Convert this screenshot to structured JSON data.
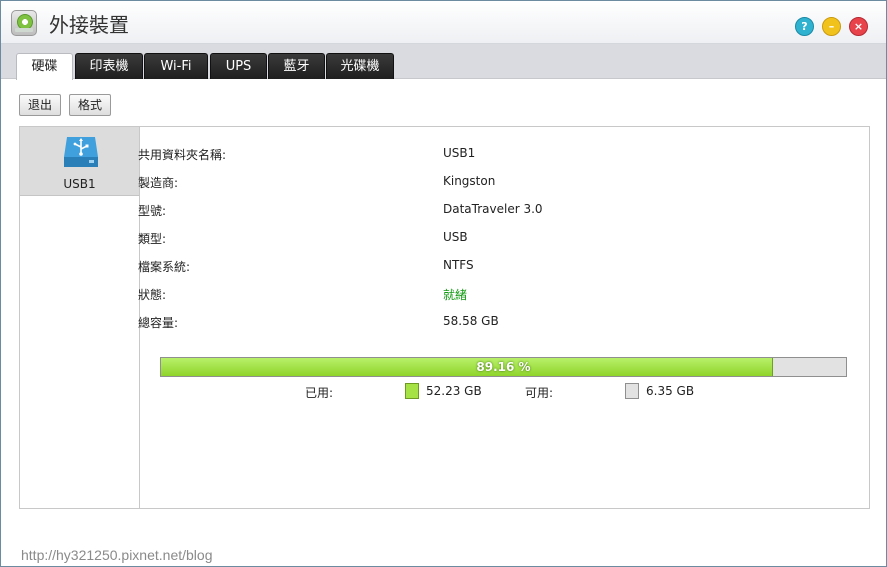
{
  "window": {
    "title": "外接裝置",
    "icon": "external-device-app-icon",
    "controls": {
      "help": "?",
      "minimize": "–",
      "close": "×"
    }
  },
  "tabs": [
    {
      "label": "硬碟",
      "active": true
    },
    {
      "label": "印表機",
      "active": false
    },
    {
      "label": "Wi-Fi",
      "active": false
    },
    {
      "label": "UPS",
      "active": false
    },
    {
      "label": "藍牙",
      "active": false
    },
    {
      "label": "光碟機",
      "active": false
    }
  ],
  "toolbar": {
    "eject_label": "退出",
    "format_label": "格式"
  },
  "sidebar": {
    "devices": [
      {
        "label": "USB1",
        "icon": "usb-drive-icon",
        "selected": true
      }
    ]
  },
  "details": {
    "rows": [
      {
        "label": "共用資料夾名稱:",
        "value": "USB1"
      },
      {
        "label": "製造商:",
        "value": "Kingston"
      },
      {
        "label": "型號:",
        "value": "DataTraveler 3.0"
      },
      {
        "label": "類型:",
        "value": "USB"
      },
      {
        "label": "檔案系統:",
        "value": "NTFS"
      },
      {
        "label": "狀態:",
        "value": "就緒"
      },
      {
        "label": "總容量:",
        "value": "58.58 GB"
      }
    ]
  },
  "usage": {
    "percent_text": "89.16 %",
    "used_fraction": 0.8916,
    "used_label": "已用:",
    "used_value": "52.23 GB",
    "free_label": "可用:",
    "free_value": "6.35 GB",
    "colors": {
      "used": "#a6e244",
      "free": "#e2e2e2",
      "status_ok": "#139a13"
    }
  },
  "watermark": "http://hy321250.pixnet.net/blog"
}
